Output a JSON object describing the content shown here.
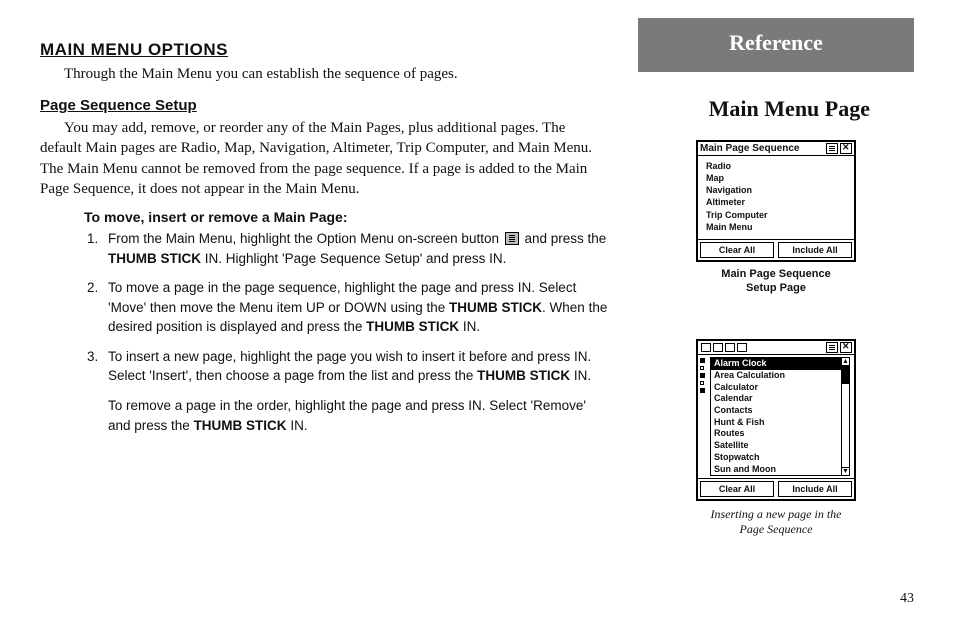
{
  "left": {
    "heading1": "MAIN MENU OPTIONS",
    "intro": "Through the Main Menu you can establish the sequence of pages.",
    "heading2": "Page Sequence Setup",
    "para1": "You may add, remove, or reorder any of the Main Pages, plus additional pages.  The default Main pages are Radio, Map, Navigation, Altimeter, Trip Computer, and Main Menu.  The Main Menu cannot be removed from the page sequence.  If a page is added to the Main Page Sequence, it does not appear in the Main Menu.",
    "heading3": "To move, insert or remove a Main Page:",
    "step1_a": "From the Main Menu, highlight the Option Menu on-screen button ",
    "step1_b": " and press the ",
    "step1_c": "THUMB STICK",
    "step1_d": " IN.  Highlight 'Page Sequence Setup' and press IN.",
    "step2_a": "To move a page in the page sequence, highlight the page and press IN.  Select 'Move' then move the Menu item UP or DOWN using the ",
    "step2_b": "THUMB STICK",
    "step2_c": ".  When the desired position is displayed and press the ",
    "step2_d": "THUMB STICK",
    "step2_e": " IN.",
    "step3_a": "To insert a new page, highlight the page you wish to insert it before and press IN.  Select 'Insert', then choose a page from the list and press the ",
    "step3_b": "THUMB STICK",
    "step3_c": " IN.",
    "step3_tail_a": "To remove a page in the order, highlight the page and press IN.  Select 'Remove' and press the ",
    "step3_tail_b": "THUMB STICK",
    "step3_tail_c": " IN."
  },
  "right": {
    "reference": "Reference",
    "section_title": "Main Menu Page",
    "device1": {
      "title": "Main Page Sequence",
      "items": [
        "Radio",
        "Map",
        "Navigation",
        "Altimeter",
        "Trip Computer",
        "Main Menu"
      ],
      "clear": "Clear All",
      "include": "Include All",
      "caption_l1": "Main Page Sequence",
      "caption_l2": "Setup Page"
    },
    "device2": {
      "items": [
        "Alarm Clock",
        "Area Calculation",
        "Calculator",
        "Calendar",
        "Contacts",
        "Hunt & Fish",
        "Routes",
        "Satellite",
        "Stopwatch",
        "Sun and Moon"
      ],
      "highlight_index": 0,
      "clear": "Clear All",
      "include": "Include All",
      "caption_l1": "Inserting a new page in the",
      "caption_l2": "Page Sequence"
    }
  },
  "page_number": "43"
}
